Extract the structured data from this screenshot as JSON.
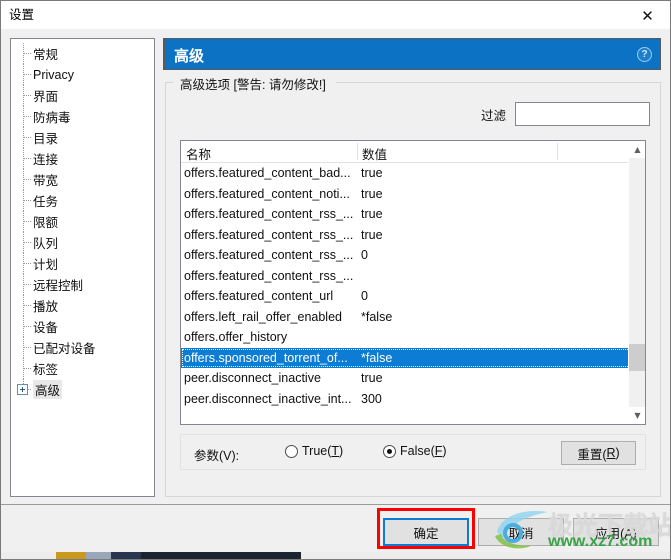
{
  "window": {
    "title": "设置",
    "close_icon": "close-icon"
  },
  "sidebar": {
    "items": [
      {
        "label": "常规",
        "expandable": false,
        "selected": false
      },
      {
        "label": "Privacy",
        "expandable": false,
        "selected": false
      },
      {
        "label": "界面",
        "expandable": false,
        "selected": false
      },
      {
        "label": "防病毒",
        "expandable": false,
        "selected": false
      },
      {
        "label": "目录",
        "expandable": false,
        "selected": false
      },
      {
        "label": "连接",
        "expandable": false,
        "selected": false
      },
      {
        "label": "带宽",
        "expandable": false,
        "selected": false
      },
      {
        "label": "任务",
        "expandable": false,
        "selected": false
      },
      {
        "label": "限额",
        "expandable": false,
        "selected": false
      },
      {
        "label": "队列",
        "expandable": false,
        "selected": false
      },
      {
        "label": "计划",
        "expandable": false,
        "selected": false
      },
      {
        "label": "远程控制",
        "expandable": false,
        "selected": false
      },
      {
        "label": "播放",
        "expandable": false,
        "selected": false
      },
      {
        "label": "设备",
        "expandable": false,
        "selected": false
      },
      {
        "label": "已配对设备",
        "expandable": false,
        "selected": false
      },
      {
        "label": "标签",
        "expandable": false,
        "selected": false
      },
      {
        "label": "高级",
        "expandable": true,
        "selected": true
      }
    ]
  },
  "page": {
    "header_title": "高级",
    "help_icon": "help-icon",
    "group_legend": "高级选项 [警告: 请勿修改!]"
  },
  "filter": {
    "label": "过滤",
    "value": "",
    "placeholder": ""
  },
  "list": {
    "columns": [
      "名称",
      "数值"
    ],
    "rows": [
      {
        "name": "offers.featured_content_bad...",
        "value": "true",
        "selected": false
      },
      {
        "name": "offers.featured_content_noti...",
        "value": "true",
        "selected": false
      },
      {
        "name": "offers.featured_content_rss_...",
        "value": "true",
        "selected": false
      },
      {
        "name": "offers.featured_content_rss_...",
        "value": "true",
        "selected": false
      },
      {
        "name": "offers.featured_content_rss_...",
        "value": "0",
        "selected": false
      },
      {
        "name": "offers.featured_content_rss_...",
        "value": "",
        "selected": false
      },
      {
        "name": "offers.featured_content_url",
        "value": "0",
        "selected": false
      },
      {
        "name": "offers.left_rail_offer_enabled",
        "value": "*false",
        "selected": false
      },
      {
        "name": "offers.offer_history",
        "value": "",
        "selected": false
      },
      {
        "name": "offers.sponsored_torrent_of...",
        "value": "*false",
        "selected": true
      },
      {
        "name": "peer.disconnect_inactive",
        "value": "true",
        "selected": false
      },
      {
        "name": "peer.disconnect_inactive_int...",
        "value": "300",
        "selected": false
      }
    ],
    "scrollbar": {
      "up_icon": "chevron-up-icon",
      "down_icon": "chevron-down-icon"
    }
  },
  "params": {
    "label": "参数(V):",
    "options": [
      {
        "label_text": "True(",
        "accel": "T",
        "label_tail": ")",
        "checked": false
      },
      {
        "label_text": "False(",
        "accel": "F",
        "label_tail": ")",
        "checked": true
      }
    ],
    "reset": {
      "text": "重置(",
      "accel": "R",
      "tail": ")"
    }
  },
  "footer": {
    "ok": "确定",
    "cancel": "取消",
    "apply": "应用(A)"
  },
  "watermark": {
    "text": "极光下载站",
    "url": "www.xz7.com"
  },
  "colors": {
    "header_blue": "#0c72c4",
    "selection_blue": "#0c7cd5",
    "highlight_red": "#ff0000",
    "dialog_bg": "#f0f0f0",
    "watermark_green": "#2e9e3e"
  }
}
